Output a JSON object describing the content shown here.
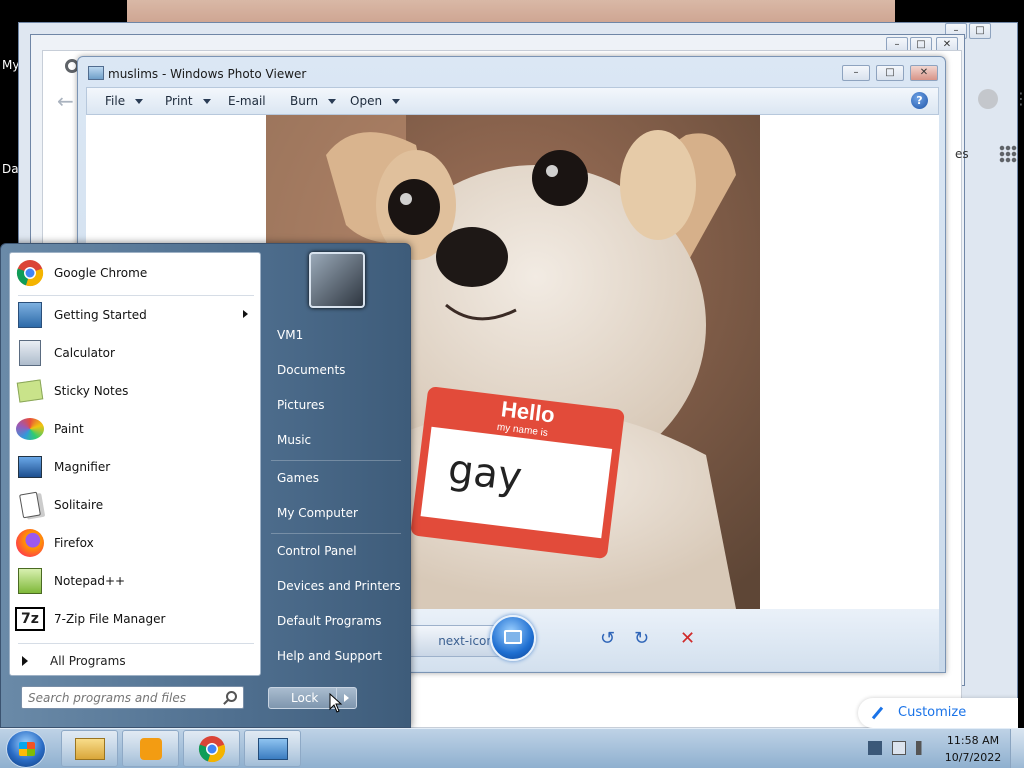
{
  "desktop": {
    "icon_label_1": "My",
    "icon_label_2": "Dat"
  },
  "chrome": {
    "right_partial_text": "es",
    "customize_label": "Customize Chrome"
  },
  "photo_viewer": {
    "title": "muslims - Windows Photo Viewer",
    "menu": {
      "file": "File",
      "print": "Print",
      "email": "E-mail",
      "burn": "Burn",
      "open": "Open"
    },
    "help_icon_glyph": "?",
    "photo": {
      "tag_hello": "Hello",
      "tag_subtitle": "my name is",
      "tag_name": "gay"
    },
    "controls": {
      "prev_icon": "prev-icon",
      "slideshow_icon": "slideshow-icon",
      "next_icon": "next-icon",
      "rotate_ccw_glyph": "↺",
      "rotate_cw_glyph": "↻",
      "delete_glyph": "✕"
    }
  },
  "start_menu": {
    "programs": [
      {
        "label": "Google Chrome"
      },
      {
        "label": "Getting Started"
      },
      {
        "label": "Calculator"
      },
      {
        "label": "Sticky Notes"
      },
      {
        "label": "Paint"
      },
      {
        "label": "Magnifier"
      },
      {
        "label": "Solitaire"
      },
      {
        "label": "Firefox"
      },
      {
        "label": "Notepad++"
      },
      {
        "label": "7-Zip File Manager"
      }
    ],
    "all_programs": "All Programs",
    "search_placeholder": "Search programs and files",
    "right_items": [
      {
        "label": "VM1"
      },
      {
        "label": "Documents"
      },
      {
        "label": "Pictures"
      },
      {
        "label": "Music"
      },
      {
        "label": "Games"
      },
      {
        "label": "My Computer"
      },
      {
        "label": "Control Panel"
      },
      {
        "label": "Devices and Printers"
      },
      {
        "label": "Default Programs"
      },
      {
        "label": "Help and Support"
      }
    ],
    "lock_label": "Lock"
  },
  "taskbar": {
    "time": "11:58 AM",
    "date": "10/7/2022"
  }
}
